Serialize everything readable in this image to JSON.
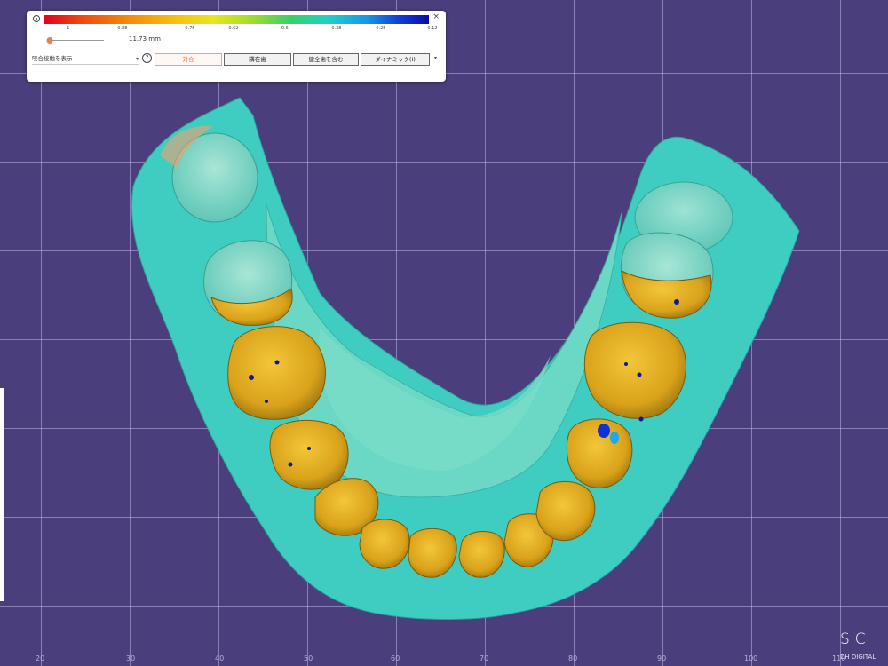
{
  "scale": {
    "labels": [
      "-1",
      "-0.88",
      "-0.75",
      "-0.62",
      "-0.5",
      "-0.38",
      "-0.25",
      "-0.12"
    ]
  },
  "slider": {
    "value_fraction": 0.05
  },
  "depth_readout": "11.73 mm",
  "display_select": {
    "label": "咬合接触を表示"
  },
  "buttons": [
    {
      "label": "対合",
      "active": true
    },
    {
      "label": "隣在歯",
      "active": false
    },
    {
      "label": "健全歯を含む",
      "active": false
    },
    {
      "label": "ダイナミック(I)",
      "active": false
    }
  ],
  "axis_ticks": [
    "20",
    "30",
    "40",
    "50",
    "60",
    "70",
    "80",
    "90",
    "100",
    "110"
  ],
  "brand": {
    "text": "SC",
    "sub": "DH DIGITAL"
  },
  "colors": {
    "tissue": "#4fd3c4",
    "tooth": "#e6b21f",
    "background": "#4b3e7c",
    "accent": "#ef7449"
  },
  "icons": {
    "pin": "pin-icon",
    "close": "close-icon",
    "help": "help-icon",
    "chevron": "chevron-down-icon"
  }
}
